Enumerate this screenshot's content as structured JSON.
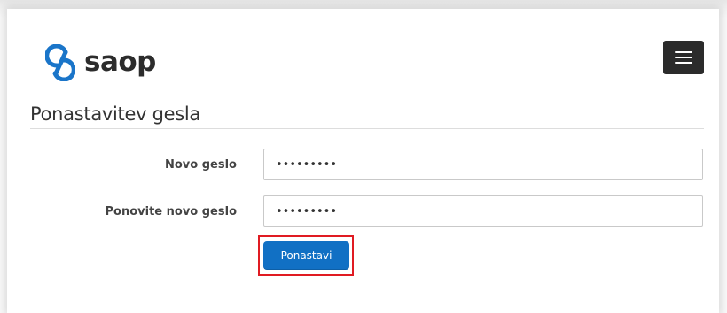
{
  "header": {
    "brand_name": "saop",
    "logo_icon": "saop-logo-icon",
    "menu_icon": "hamburger-menu-icon",
    "brand_color": "#1a75c9"
  },
  "page": {
    "title": "Ponastavitev gesla"
  },
  "form": {
    "new_password": {
      "label": "Novo geslo",
      "value": "•••••••••"
    },
    "repeat_password": {
      "label": "Ponovite novo geslo",
      "value": "•••••••••"
    },
    "submit_label": "Ponastavi",
    "submit_color": "#1170c4",
    "highlight_color": "#e01b22"
  }
}
